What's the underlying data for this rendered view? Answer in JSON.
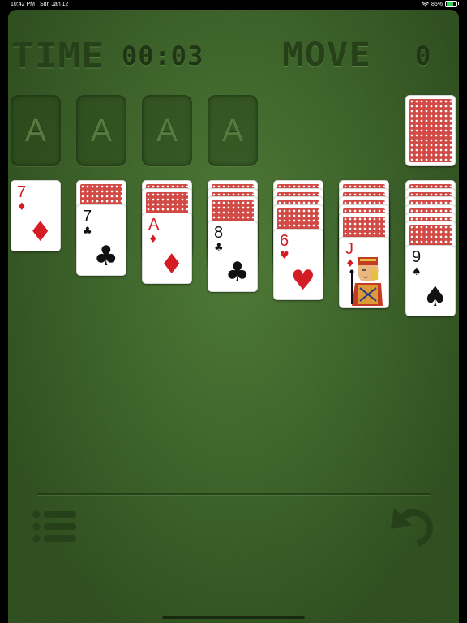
{
  "status_bar": {
    "time": "10:42 PM",
    "date": "Sun Jan 12",
    "battery": "85%"
  },
  "hud": {
    "time_label": "TIME",
    "time_value": "00:03",
    "move_label": "MOVE",
    "move_value": "0"
  },
  "foundations": [
    "A",
    "A",
    "A",
    "A"
  ],
  "stock": {
    "face": "down"
  },
  "tableau": [
    {
      "face_down": 0,
      "top": {
        "rank": "7",
        "suit": "♦",
        "color": "red"
      }
    },
    {
      "face_down": 1,
      "top": {
        "rank": "7",
        "suit": "♣",
        "color": "black"
      }
    },
    {
      "face_down": 2,
      "top": {
        "rank": "A",
        "suit": "♦",
        "color": "red"
      }
    },
    {
      "face_down": 3,
      "top": {
        "rank": "8",
        "suit": "♣",
        "color": "black"
      }
    },
    {
      "face_down": 4,
      "top": {
        "rank": "6",
        "suit": "♥",
        "color": "red"
      }
    },
    {
      "face_down": 5,
      "top": {
        "rank": "J",
        "suit": "♦",
        "color": "red"
      }
    },
    {
      "face_down": 6,
      "top": {
        "rank": "9",
        "suit": "♠",
        "color": "black"
      }
    }
  ],
  "icons": {
    "menu": "menu-list-icon",
    "undo": "undo-arrow-icon",
    "wifi": "wifi-icon",
    "battery": "battery-icon"
  },
  "colors": {
    "felt": "#3f6a2a",
    "card_back": "#d24a45",
    "red_suit": "#d41c24"
  }
}
